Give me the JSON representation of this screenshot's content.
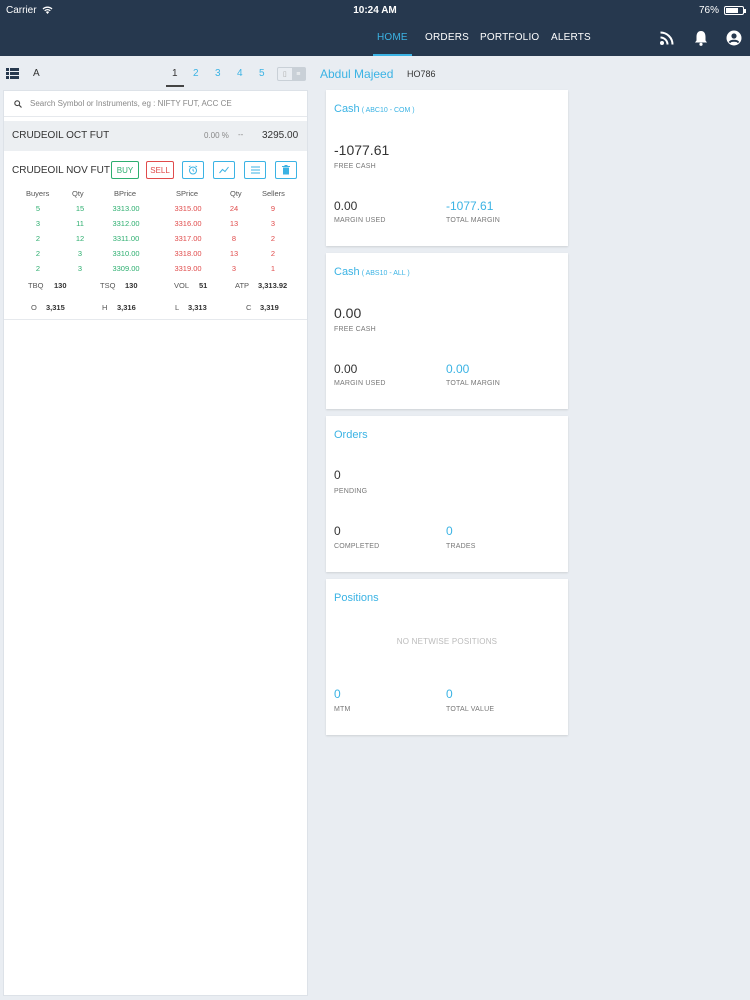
{
  "status_bar": {
    "carrier": "Carrier",
    "time": "10:24 AM",
    "battery": "76%",
    "battery_level": 0.76
  },
  "nav": {
    "home": "HOME",
    "orders": "ORDERS",
    "portfolio": "PORTFOLIO",
    "alerts": "ALERTS",
    "active": "HOME"
  },
  "watchlist": {
    "letter": "A",
    "pages": [
      "1",
      "2",
      "3",
      "4",
      "5"
    ],
    "active_page": "1",
    "search_placeholder": "Search Symbol or Instruments, eg : NIFTY FUT, ACC CE",
    "symbols": [
      {
        "name": "CRUDEOIL OCT FUT",
        "change": "0.00 %",
        "arrow": "--",
        "price": "3295.00"
      },
      {
        "name": "CRUDEOIL NOV FUT"
      }
    ],
    "buttons": {
      "buy": "BUY",
      "sell": "SELL"
    },
    "depth_headers": [
      "Buyers",
      "Qty",
      "BPrice",
      "SPrice",
      "Qty",
      "Sellers"
    ],
    "depth_rows": [
      [
        "5",
        "15",
        "3313.00",
        "3315.00",
        "24",
        "9"
      ],
      [
        "3",
        "11",
        "3312.00",
        "3316.00",
        "13",
        "3"
      ],
      [
        "2",
        "12",
        "3311.00",
        "3317.00",
        "8",
        "2"
      ],
      [
        "2",
        "3",
        "3310.00",
        "3318.00",
        "13",
        "2"
      ],
      [
        "2",
        "3",
        "3309.00",
        "3319.00",
        "3",
        "1"
      ]
    ],
    "stats_row1": [
      {
        "label": "TBQ",
        "value": "130"
      },
      {
        "label": "TSQ",
        "value": "130"
      },
      {
        "label": "VOL",
        "value": "51"
      },
      {
        "label": "ATP",
        "value": "3,313.92"
      }
    ],
    "stats_row2": [
      {
        "label": "O",
        "value": "3,315"
      },
      {
        "label": "H",
        "value": "3,316"
      },
      {
        "label": "L",
        "value": "3,313"
      },
      {
        "label": "C",
        "value": "3,319"
      }
    ]
  },
  "user": {
    "name": "Abdul Majeed",
    "id": "HO786"
  },
  "cards": {
    "cash1": {
      "title": "Cash",
      "sub": "( ABC10 - COM )",
      "free_cash": "-1077.61",
      "free_cash_label": "FREE CASH",
      "margin_used": "0.00",
      "margin_used_label": "MARGIN USED",
      "total_margin": "-1077.61",
      "total_margin_label": "TOTAL MARGIN"
    },
    "cash2": {
      "title": "Cash",
      "sub": "( ABS10 - ALL )",
      "free_cash": "0.00",
      "free_cash_label": "FREE CASH",
      "margin_used": "0.00",
      "margin_used_label": "MARGIN USED",
      "total_margin": "0.00",
      "total_margin_label": "TOTAL MARGIN"
    },
    "orders": {
      "title": "Orders",
      "pending": "0",
      "pending_label": "PENDING",
      "completed": "0",
      "completed_label": "COMPLETED",
      "trades": "0",
      "trades_label": "TRADES"
    },
    "positions": {
      "title": "Positions",
      "empty": "NO NETWISE POSITIONS",
      "mtm": "0",
      "mtm_label": "MTM",
      "total_value": "0",
      "total_value_label": "TOTAL VALUE"
    }
  },
  "colors": {
    "nav_bg": "#26384e",
    "accent": "#3bb3e4",
    "buy": "#2cae6f",
    "sell": "#e04b4b"
  }
}
